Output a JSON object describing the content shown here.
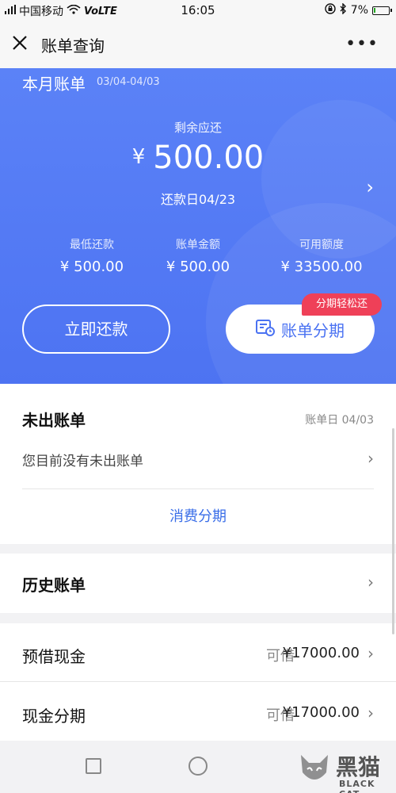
{
  "status_bar": {
    "carrier": "中国移动",
    "network": "VoLTE",
    "time": "16:05",
    "battery_percent": 0.07,
    "battery_text": "7%"
  },
  "nav": {
    "title": "账单查询",
    "close_icon": "close-icon",
    "more_icon": "more-dots-icon",
    "more_label": "•••"
  },
  "hero": {
    "month_title": "本月账单",
    "month_range": "03/04-04/03",
    "remaining_label": "剩余应还",
    "currency": "¥",
    "remaining_amount": "500.00",
    "due_date": "还款日04/23",
    "chevron": "›",
    "stats": [
      {
        "label": "最低还款",
        "value": "¥ 500.00"
      },
      {
        "label": "账单金额",
        "value": "¥ 500.00"
      },
      {
        "label": "可用额度",
        "value": "¥ 33500.00"
      }
    ],
    "pay_button": "立即还款",
    "installment_button": "账单分期",
    "installment_badge": "分期轻松还",
    "colors": {
      "background": "#5077f4",
      "badge": "#ef4058",
      "accent": "#4a72f2"
    }
  },
  "unbilled": {
    "title": "未出账单",
    "bill_date": "账单日 04/03",
    "message": "您目前没有未出账单",
    "consume_installment": "消费分期",
    "chevron": "›"
  },
  "history": {
    "title": "历史账单",
    "chevron": "›"
  },
  "loans": [
    {
      "label": "预借现金",
      "availability": "可借",
      "amount": "¥17000.00",
      "chevron": "›"
    },
    {
      "label": "现金分期",
      "availability": "可借",
      "amount": "¥17000.00",
      "chevron": "›"
    }
  ],
  "watermark": {
    "cn": "黑猫",
    "en": "BLACK CAT"
  }
}
